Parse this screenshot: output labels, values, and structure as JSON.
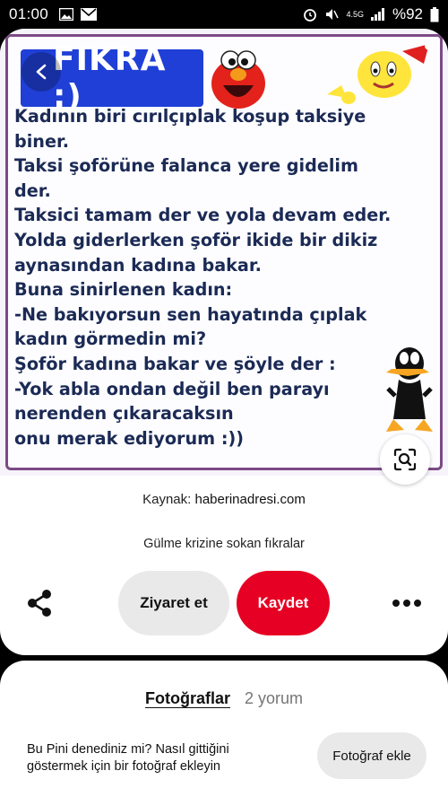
{
  "status_bar": {
    "time": "01:00",
    "network": "4.5G",
    "battery": "%92"
  },
  "pin": {
    "title": "FIKRA :)",
    "joke_lines": [
      "Kadının biri cırılçıplak koşup taksiye",
      "biner.",
      "Taksi şoförüne falanca yere gidelim",
      "der.",
      "Taksici tamam der ve yola devam eder.",
      "Yolda giderlerken şoför ikide bir dikiz",
      "aynasından kadına bakar.",
      "Buna sinirlenen kadın:",
      "-Ne bakıyorsun sen hayatında çıplak",
      "kadın görmedin mi?",
      "Şoför kadına bakar ve şöyle der :",
      "-Yok abla ondan değil ben parayı",
      "nerenden çıkaracaksın",
      "onu merak ediyorum :))"
    ],
    "source_label": "Kaynak:",
    "source_domain": "haberinadresi.com",
    "description": "Gülme krizine sokan fıkralar"
  },
  "actions": {
    "visit_label": "Ziyaret et",
    "save_label": "Kaydet"
  },
  "comments": {
    "tab_photos": "Fotoğraflar",
    "tab_comments": "2 yorum",
    "prompt_text": "Bu Pini denediniz mi? Nasıl gittiğini göstermek için bir fotoğraf ekleyin",
    "add_photo_label": "Fotoğraf ekle"
  },
  "colors": {
    "save_red": "#e60023",
    "title_blue": "#1f3fd6",
    "frame_purple": "#7d4a86"
  }
}
